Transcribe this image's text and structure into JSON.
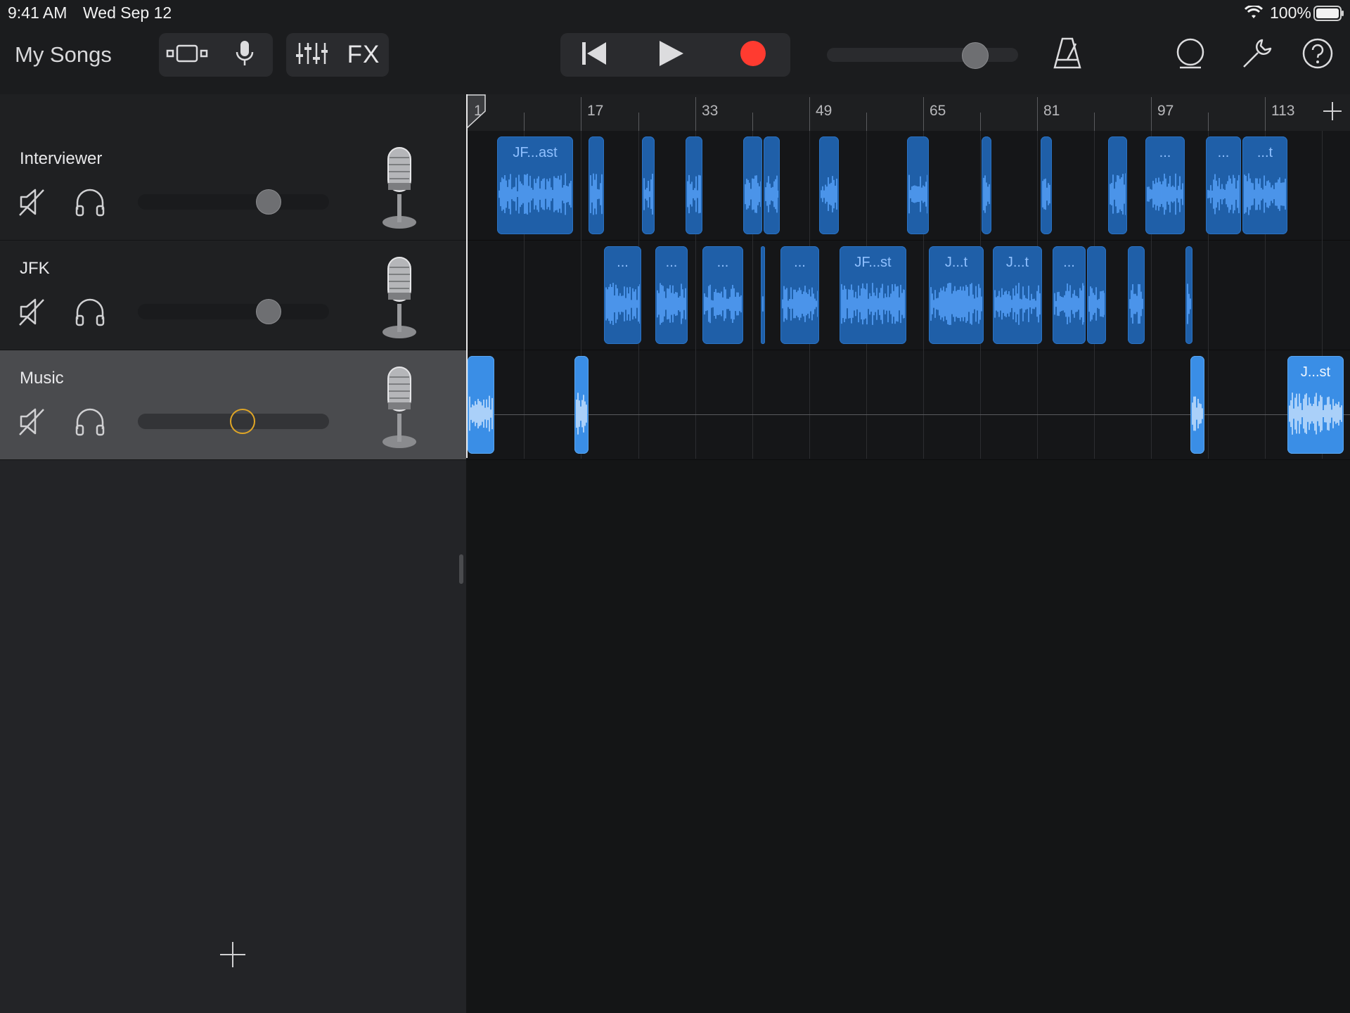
{
  "status_bar": {
    "time": "9:41 AM",
    "date": "Wed Sep 12",
    "battery": "100%"
  },
  "toolbar": {
    "my_songs": "My Songs",
    "fx": "FX",
    "record_color": "#ff3b30",
    "master_volume": 0.8
  },
  "ruler": {
    "bars": [
      "1",
      "17",
      "33",
      "49",
      "65",
      "81",
      "97",
      "113"
    ]
  },
  "tracks": [
    {
      "name": "Interviewer",
      "volume": 0.68
    },
    {
      "name": "JFK",
      "volume": 0.68
    },
    {
      "name": "Music",
      "volume": 0.55,
      "selected": true
    }
  ],
  "regions": {
    "interviewer": [
      "JF...ast",
      "...",
      "...",
      "...t"
    ],
    "jfk": [
      "...",
      "...",
      "...",
      "...",
      "JF...st",
      "J...t",
      "J...t",
      "..."
    ],
    "music": [
      "J...st"
    ]
  },
  "colors": {
    "accent_region": "#1f5fa8",
    "selected_region": "#3a8ee6",
    "selected_knob": "#e0a626"
  }
}
